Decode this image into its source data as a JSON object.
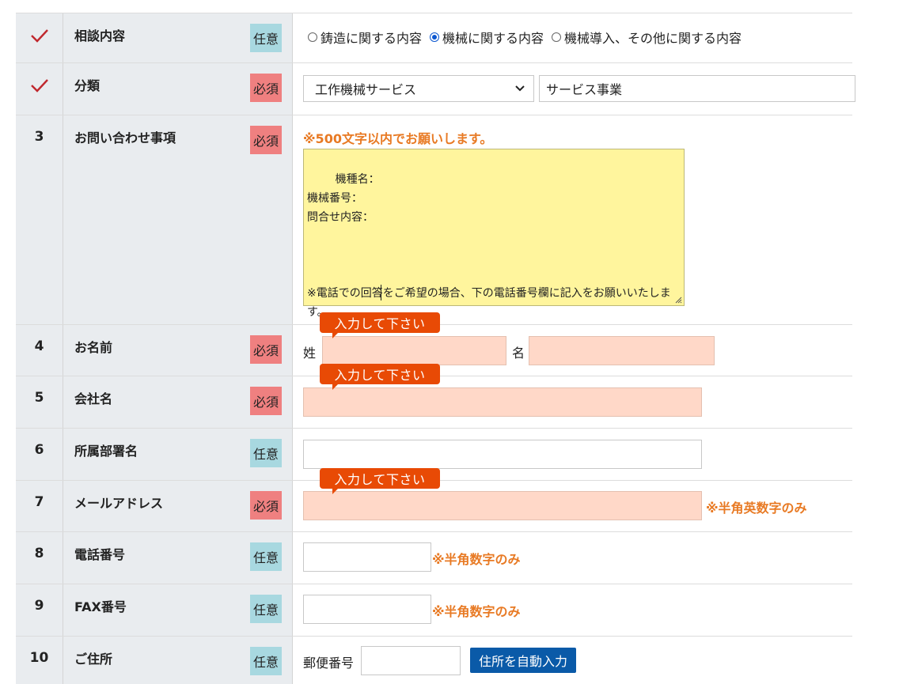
{
  "rows": [
    {
      "num": "",
      "label": "相談内容",
      "badge": "任意"
    },
    {
      "num": "",
      "label": "分類",
      "badge": "必須"
    },
    {
      "num": "3",
      "label": "お問い合わせ事項",
      "badge": "必須"
    },
    {
      "num": "4",
      "label": "お名前",
      "badge": "必須"
    },
    {
      "num": "5",
      "label": "会社名",
      "badge": "必須"
    },
    {
      "num": "6",
      "label": "所属部署名",
      "badge": "任意"
    },
    {
      "num": "7",
      "label": "メールアドレス",
      "badge": "必須"
    },
    {
      "num": "8",
      "label": "電話番号",
      "badge": "任意"
    },
    {
      "num": "9",
      "label": "FAX番号",
      "badge": "任意"
    },
    {
      "num": "10",
      "label": "ご住所",
      "badge": "任意"
    }
  ],
  "consult": {
    "options": [
      "鋳造に関する内容",
      "機械に関する内容",
      "機械導入、その他に関する内容"
    ],
    "selected_index": 1
  },
  "category": {
    "select_value": "工作機械サービス",
    "sub_value": "サービス事業"
  },
  "inquiry": {
    "note": "※500文字以内でお願いします。",
    "text": "機種名：\n機械番号：\n問合せ内容：\n\n\n\n※電話での回答をご希望の場合、下の電話番号欄に記入をお願いいたします。"
  },
  "name": {
    "last_label": "姓",
    "first_label": "名"
  },
  "tooltip": "入力して下さい",
  "email_note": "※半角英数字のみ",
  "phone_note": "※半角数字のみ",
  "fax_note": "※半角数字のみ",
  "address": {
    "postal_label": "郵便番号",
    "auto_button": "住所を自動入力"
  },
  "colors": {
    "required": "#ef8080",
    "optional": "#a8d8e0",
    "error_field": "#ffd8c8",
    "tooltip": "#e84a05",
    "note": "#e87a24",
    "button": "#0a5aa8",
    "check": "#c0282e"
  }
}
